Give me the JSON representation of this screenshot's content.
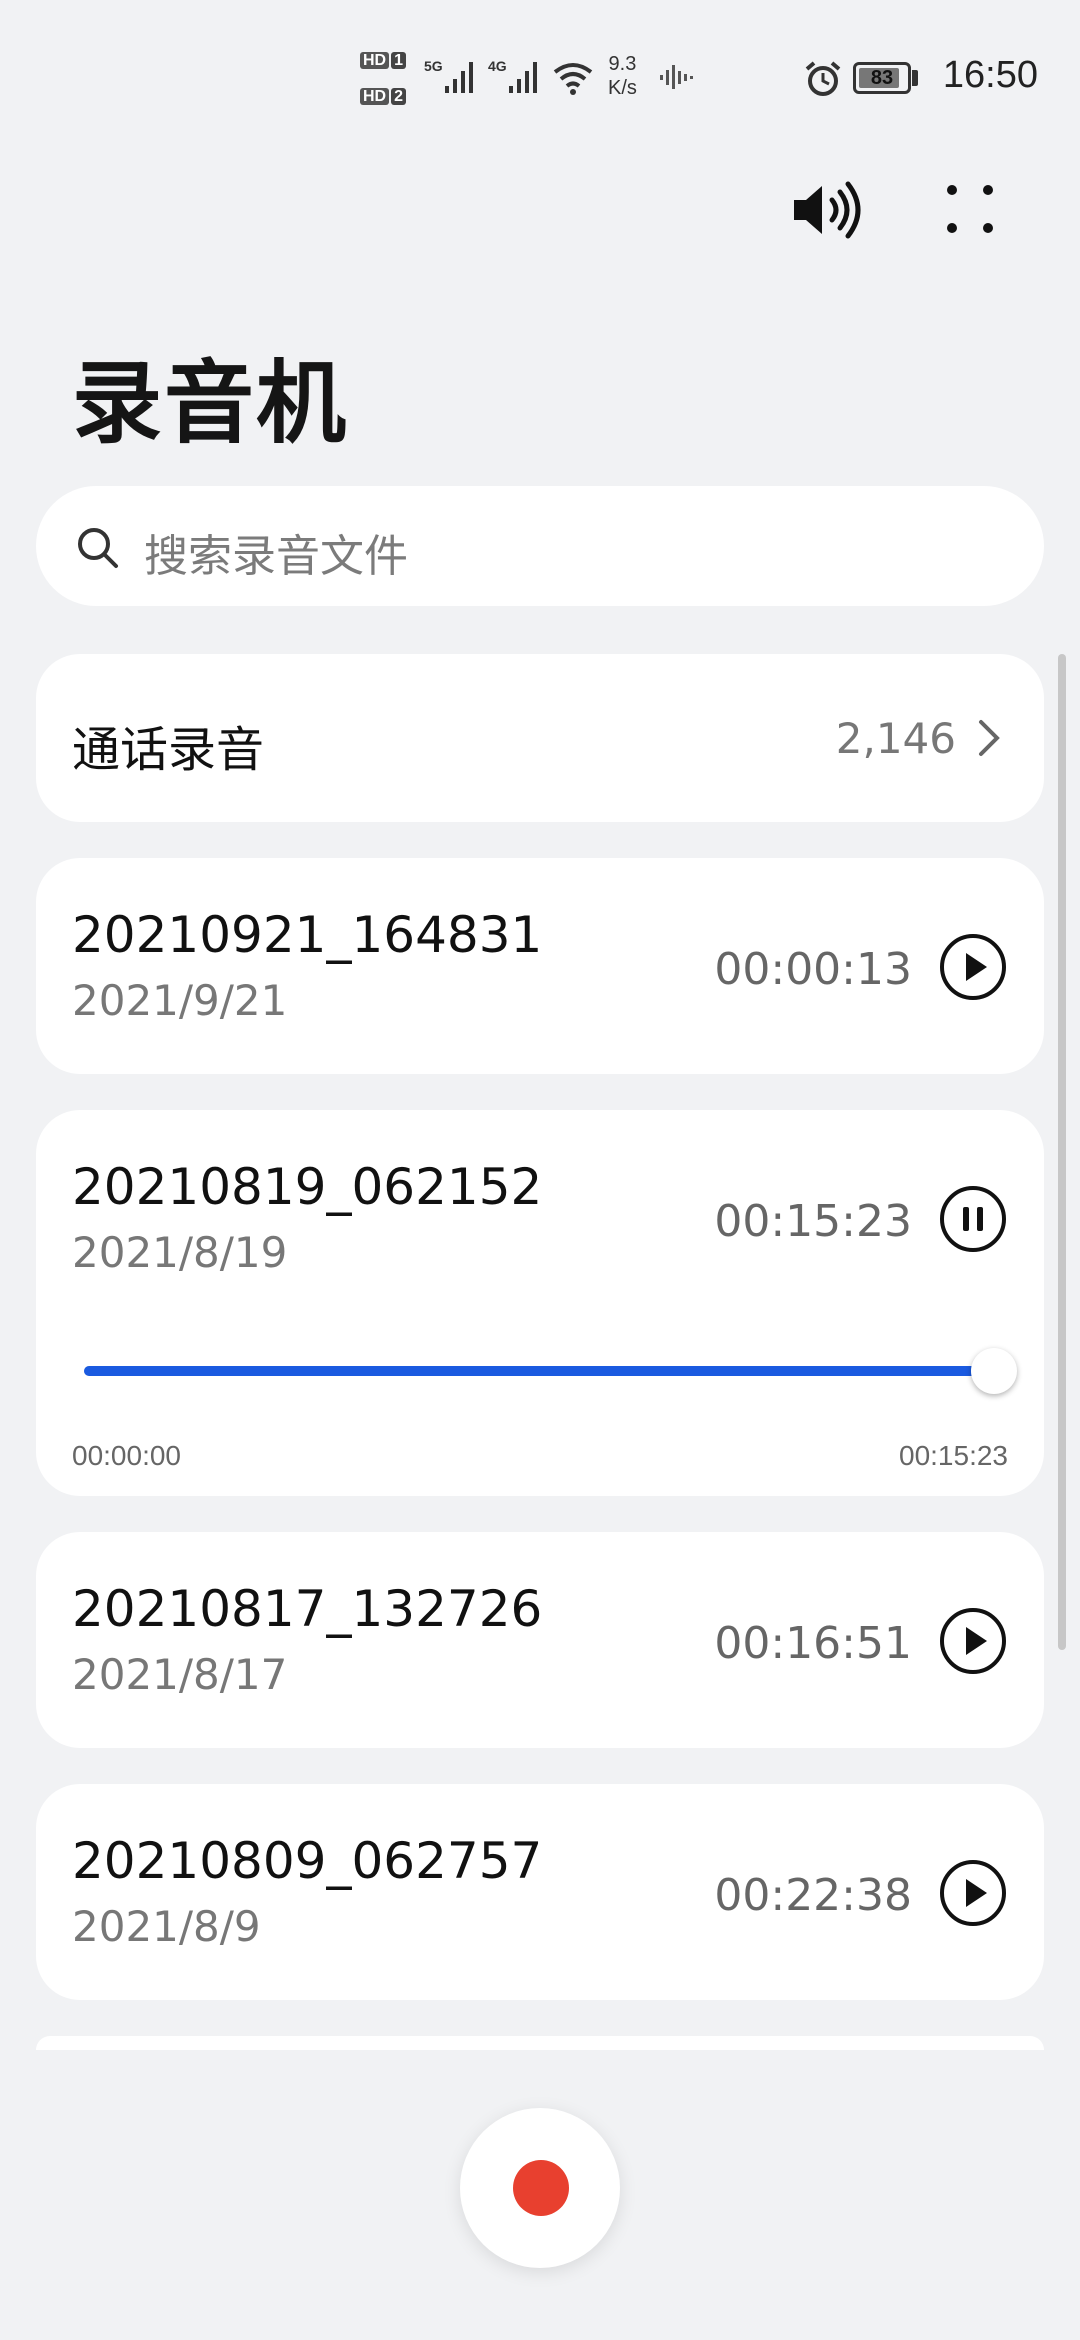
{
  "status_bar": {
    "hd1": "HD",
    "hd1_sim": "1",
    "hd2": "HD",
    "hd2_sim": "2",
    "net1": "5G",
    "net2": "4G",
    "speed_value": "9.3",
    "speed_unit": "K/s",
    "battery": "83",
    "time": "16:50"
  },
  "header": {
    "title": "录音机",
    "speaker_icon": "speaker-icon",
    "more_icon": "more-dots-icon"
  },
  "search": {
    "placeholder": "搜索录音文件",
    "icon": "search-icon"
  },
  "call_recordings": {
    "label": "通话录音",
    "count": "2,146"
  },
  "recordings": [
    {
      "name": "20210921_164831",
      "date": "2021/9/21",
      "duration": "00:00:13",
      "state": "paused"
    },
    {
      "name": "20210819_062152",
      "date": "2021/8/19",
      "duration": "00:15:23",
      "state": "playing",
      "progress": {
        "current": "00:00:00",
        "total": "00:15:23",
        "fraction": 1.0
      }
    },
    {
      "name": "20210817_132726",
      "date": "2021/8/17",
      "duration": "00:16:51",
      "state": "paused"
    },
    {
      "name": "20210809_062757",
      "date": "2021/8/9",
      "duration": "00:22:38",
      "state": "paused"
    }
  ],
  "colors": {
    "accent": "#1a5ae0",
    "record": "#e8402f",
    "background": "#f1f2f4"
  }
}
